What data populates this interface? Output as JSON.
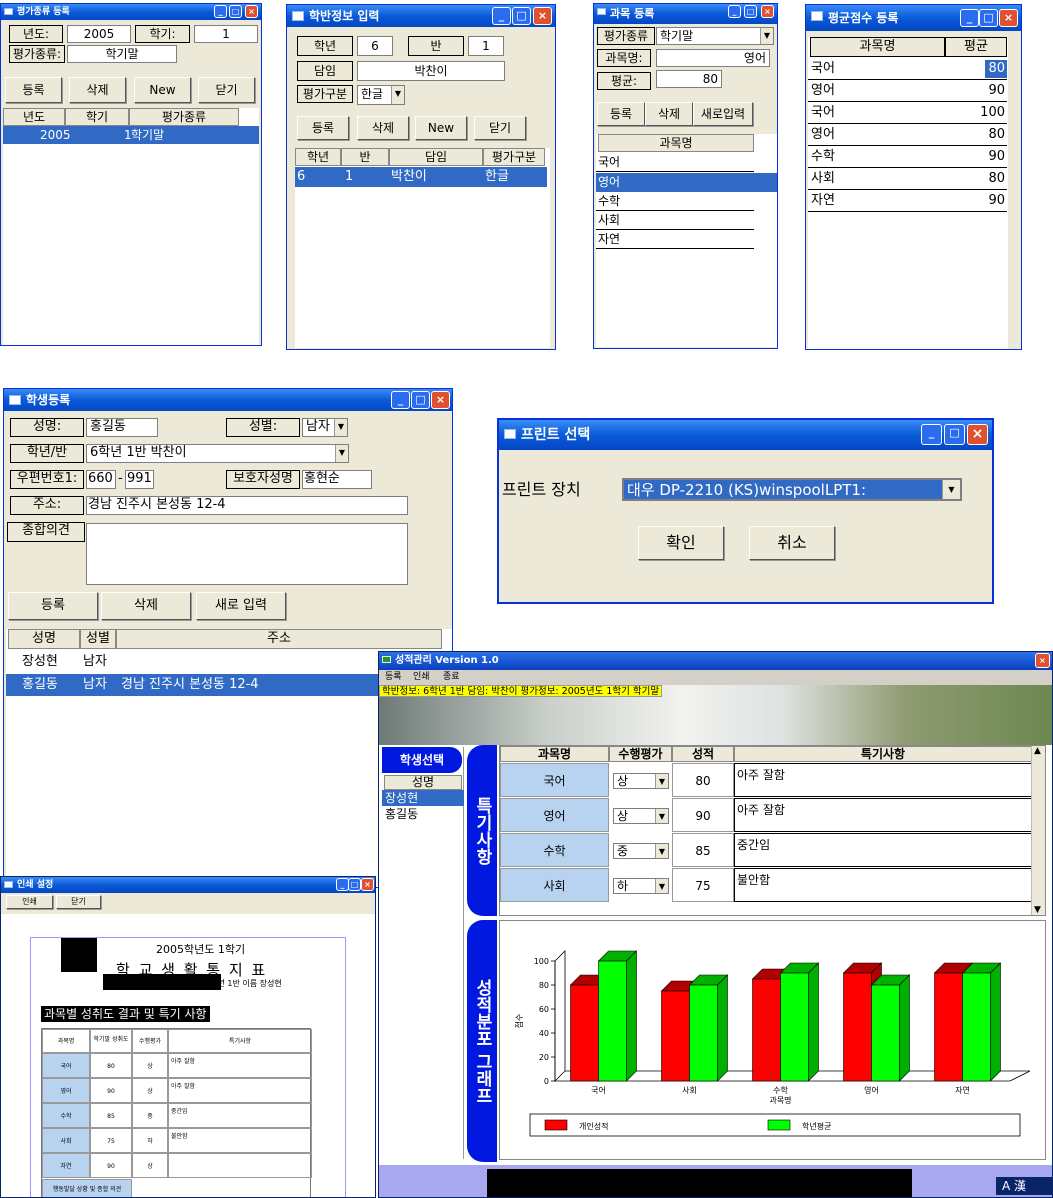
{
  "eval_type": {
    "title": "평가종류 등록",
    "year_label": "년도:",
    "year_value": "2005",
    "term_label": "학기:",
    "term_value": "1",
    "type_label": "평가종류:",
    "type_value": "학기말",
    "buttons": [
      "등록",
      "삭제",
      "New",
      "닫기"
    ],
    "columns": [
      "년도",
      "학기",
      "평가종류"
    ],
    "rows": [
      {
        "year": "2005",
        "term": "1",
        "type": "학기말"
      }
    ]
  },
  "class_info": {
    "title": "학반정보 입력",
    "grade_label": "학년",
    "grade_value": "6",
    "class_label": "반",
    "class_value": "1",
    "teacher_label": "담임",
    "teacher_value": "박찬이",
    "eval_label": "평가구분",
    "eval_value": "한글",
    "buttons": [
      "등록",
      "삭제",
      "New",
      "닫기"
    ],
    "columns": [
      "학년",
      "반",
      "담임",
      "평가구분"
    ],
    "rows": [
      {
        "grade": "6",
        "class": "1",
        "teacher": "박찬이",
        "eval": "한글"
      }
    ]
  },
  "subject_reg": {
    "title": "과목 등록",
    "eval_label": "평가종류",
    "eval_value": "학기말",
    "subject_label": "과목명:",
    "subject_value": "영어",
    "avg_label": "평균:",
    "avg_value": "80",
    "buttons": [
      "등록",
      "삭제",
      "새로입력"
    ],
    "column": "과목명",
    "rows": [
      "국어",
      "영어",
      "수학",
      "사회",
      "자연"
    ]
  },
  "avg_score": {
    "title": "평균점수 등록",
    "columns": [
      "과목명",
      "평균"
    ],
    "rows": [
      {
        "subject": "국어",
        "avg": "80"
      },
      {
        "subject": "영어",
        "avg": "90"
      },
      {
        "subject": "국어",
        "avg": "100"
      },
      {
        "subject": "영어",
        "avg": "80"
      },
      {
        "subject": "수학",
        "avg": "90"
      },
      {
        "subject": "사회",
        "avg": "80"
      },
      {
        "subject": "자연",
        "avg": "90"
      }
    ]
  },
  "student_reg": {
    "title": "학생등록",
    "name_label": "성명:",
    "name_value": "홍길동",
    "gender_label": "성별:",
    "gender_value": "남자",
    "class_label": "학년/반",
    "class_value": "6학년  1반  박찬이",
    "zip_label": "우편번호1:",
    "zip1": "660",
    "zip_sep": "-",
    "zip2": "991",
    "guardian_label": "보호자성명",
    "guardian_value": "홍현순",
    "addr_label": "주소:",
    "addr_value": "경남 진주시 본성동 12-4",
    "opinion_label": "종합의견",
    "buttons": [
      "등록",
      "삭제",
      "새로 입력"
    ],
    "columns": [
      "성명",
      "성별",
      "주소"
    ],
    "rows": [
      {
        "name": "장성현",
        "gender": "남자",
        "addr": ""
      },
      {
        "name": "홍길동",
        "gender": "남자",
        "addr": "경남 진주시 본성동 12-4"
      }
    ]
  },
  "print_select": {
    "title": "프린트 선택",
    "device_label": "프린트 장치",
    "device_value": "대우 DP-2210 (KS)winspoolLPT1:",
    "ok": "확인",
    "cancel": "취소"
  },
  "print_setup": {
    "title": "인쇄 설정",
    "buttons": [
      "인쇄",
      "닫기"
    ],
    "report_year": "2005학년도 1학기",
    "report_title": "학 교 생 활 통 지 표",
    "report_student": "6학년   1반   이름  장성현",
    "section_title": "과목별 성취도 결과 및 특기 사항",
    "columns": [
      "과목명",
      "학기말 성취도",
      "수행평가",
      "특기사항"
    ],
    "rows": [
      {
        "subject": "국어",
        "score": "80",
        "perf": "상",
        "note": "아주 잘함"
      },
      {
        "subject": "영어",
        "score": "90",
        "perf": "상",
        "note": "아주 잘함"
      },
      {
        "subject": "수학",
        "score": "85",
        "perf": "중",
        "note": "중간임"
      },
      {
        "subject": "사회",
        "score": "75",
        "perf": "하",
        "note": "불안함"
      },
      {
        "subject": "자연",
        "score": "90",
        "perf": "상",
        "note": ""
      }
    ],
    "footer_label": "행동발달 상황 및 종합 의견"
  },
  "main": {
    "title": "성적관리 Version 1.0",
    "menu": [
      "등록",
      "인쇄",
      "종료"
    ],
    "status": "학반정보: 6학년 1반 담임: 박찬이    평가정보: 2005년도 1학기 학기말",
    "student_select": "학생선택",
    "student_col": "성명",
    "students": [
      "장성현",
      "홍길동"
    ],
    "tab_notes": "특기사항",
    "tab_graph": "성적분포 그래프",
    "columns": [
      "과목명",
      "수행평가",
      "성적",
      "특기사항"
    ],
    "rows": [
      {
        "subject": "국어",
        "perf": "상",
        "score": "80",
        "note": "아주 잘함"
      },
      {
        "subject": "영어",
        "perf": "상",
        "score": "90",
        "note": "아주 잘함"
      },
      {
        "subject": "수학",
        "perf": "중",
        "score": "85",
        "note": "중간임"
      },
      {
        "subject": "사회",
        "perf": "하",
        "score": "75",
        "note": "불안함"
      }
    ],
    "ime": "A 漢"
  },
  "chart_data": {
    "type": "bar",
    "categories": [
      "국어",
      "사회",
      "수학",
      "영어",
      "자연"
    ],
    "series": [
      {
        "name": "개인성적",
        "color": "#ff0000",
        "values": [
          80,
          75,
          85,
          90,
          90
        ]
      },
      {
        "name": "학년평균",
        "color": "#00ff00",
        "values": [
          100,
          80,
          90,
          80,
          90
        ]
      }
    ],
    "ylim": [
      0,
      100
    ],
    "yticks": [
      0,
      20,
      40,
      60,
      80,
      100
    ],
    "xlabel": "과목명",
    "ylabel": "점수"
  }
}
